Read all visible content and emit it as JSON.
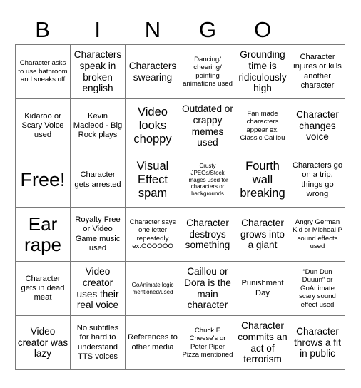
{
  "card": {
    "title_letters": [
      "B",
      "I",
      "N",
      "G",
      "O"
    ],
    "columns": 6,
    "rows": 6,
    "border_color": "#7a7a7a",
    "background_color": "#ffffff",
    "text_color": "#000000",
    "free_space_label": "Free!",
    "cells": [
      [
        {
          "text": "Character asks to use bathroom and sneaks off",
          "size": "s"
        },
        {
          "text": "Characters speak in broken english",
          "size": "l"
        },
        {
          "text": "Characters swearing",
          "size": "l"
        },
        {
          "text": "Dancing/ cheering/ pointing animations used",
          "size": "s"
        },
        {
          "text": "Grounding time is ridiculously high",
          "size": "l"
        },
        {
          "text": "Character injures or kills another character",
          "size": "m"
        }
      ],
      [
        {
          "text": "Kidaroo or Scary Voice used",
          "size": "m"
        },
        {
          "text": "Kevin Macleod - Big Rock plays",
          "size": "m"
        },
        {
          "text": "Video looks choppy",
          "size": "xl"
        },
        {
          "text": "Outdated or crappy memes used",
          "size": "l"
        },
        {
          "text": "Fan made characters appear ex. Classic Caillou",
          "size": "s"
        },
        {
          "text": "Character changes voice",
          "size": "l"
        }
      ],
      [
        {
          "text": "Free!",
          "size": "free"
        },
        {
          "text": "Character gets arrested",
          "size": "m"
        },
        {
          "text": "Visual Effect spam",
          "size": "xl"
        },
        {
          "text": "Crusty JPEGs/Stock Images used for characters or backgrounds",
          "size": "xs"
        },
        {
          "text": "Fourth wall breaking",
          "size": "xl"
        },
        {
          "text": "Characters go on a trip, things go wrong",
          "size": "m"
        }
      ],
      [
        {
          "text": "Ear rape",
          "size": "ear"
        },
        {
          "text": "Royalty Free or Video Game music used",
          "size": "m"
        },
        {
          "text": "Character says one letter repeatedly ex.OOOOOO",
          "size": "s"
        },
        {
          "text": "Character destroys something",
          "size": "l"
        },
        {
          "text": "Character grows into a giant",
          "size": "l"
        },
        {
          "text": "Angry German Kid or Micheal P sound effects used",
          "size": "s"
        }
      ],
      [
        {
          "text": "Character gets in dead meat",
          "size": "m"
        },
        {
          "text": "Video creator uses their real voice",
          "size": "l"
        },
        {
          "text": "GoAnimate logic mentioned/used",
          "size": "xs"
        },
        {
          "text": "Caillou or Dora is the main character",
          "size": "l"
        },
        {
          "text": "Punishment Day",
          "size": "m"
        },
        {
          "text": "“Dun Dun Duuun” or GoAnimate scary sound effect used",
          "size": "s"
        }
      ],
      [
        {
          "text": "Video creator was lazy",
          "size": "l"
        },
        {
          "text": "No subtitles for hard to understand TTS voices",
          "size": "m"
        },
        {
          "text": "References to other media",
          "size": "m"
        },
        {
          "text": "Chuck E Cheese's or Peter Piper Pizza mentioned",
          "size": "s"
        },
        {
          "text": "Character commits an act of terrorism",
          "size": "l"
        },
        {
          "text": "Character throws a fit in public",
          "size": "l"
        }
      ]
    ]
  }
}
